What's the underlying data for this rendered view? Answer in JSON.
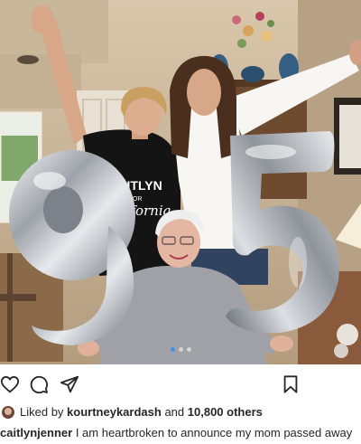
{
  "post": {
    "photo_alt": "",
    "balloon_left_digit": "9",
    "balloon_right_digit": "5",
    "shirt_text_line1": "CAITLYN",
    "shirt_text_line2": "FOR",
    "shirt_text_line3": "California",
    "carousel": {
      "count": 3,
      "active_index": 0
    }
  },
  "actions": {
    "like_icon": "heart-outline-icon",
    "comment_icon": "speech-bubble-icon",
    "share_icon": "paper-plane-icon",
    "save_icon": "bookmark-icon"
  },
  "likes": {
    "prefix": "Liked by",
    "user": "kourtneykardash",
    "conjunction": "and",
    "others": "10,800 others"
  },
  "caption": {
    "username": "caitlynjenner",
    "text": "I am heartbroken to announce my mom passed away"
  },
  "colors": {
    "text": "#262626",
    "accent": "#3897f0",
    "balloon_silver": "#c9cbcf"
  }
}
